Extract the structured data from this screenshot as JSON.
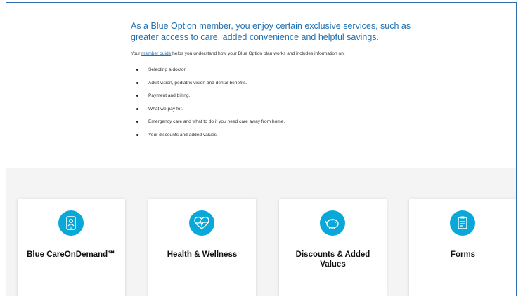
{
  "intro": {
    "text": "As a Blue Option member, you enjoy certain exclusive services, such as greater access to care, added convenience and helpful savings."
  },
  "guide": {
    "prefix": "Your ",
    "link_text": "member guide",
    "suffix": " helps you understand how your Blue Option plan works and includes information on:"
  },
  "info_list": [
    "Selecting a doctor.",
    "Adult vision, pediatric vision and dental benefits.",
    "Payment and billing.",
    "What we pay for.",
    "Emergency care and what to do if you need care away from home.",
    "Your discounts and added values."
  ],
  "cards": [
    {
      "title": "Blue CareOnDemand℠",
      "icon": "tablet-doctor-icon"
    },
    {
      "title": "Health & Wellness",
      "icon": "heart-pulse-icon"
    },
    {
      "title": "Discounts & Added Values",
      "icon": "piggy-bank-icon"
    },
    {
      "title": "Forms",
      "icon": "clipboard-icon"
    }
  ],
  "colors": {
    "accent": "#0aa7d9",
    "text_blue": "#1f6fb2",
    "band_bg": "#f4f4f4"
  }
}
